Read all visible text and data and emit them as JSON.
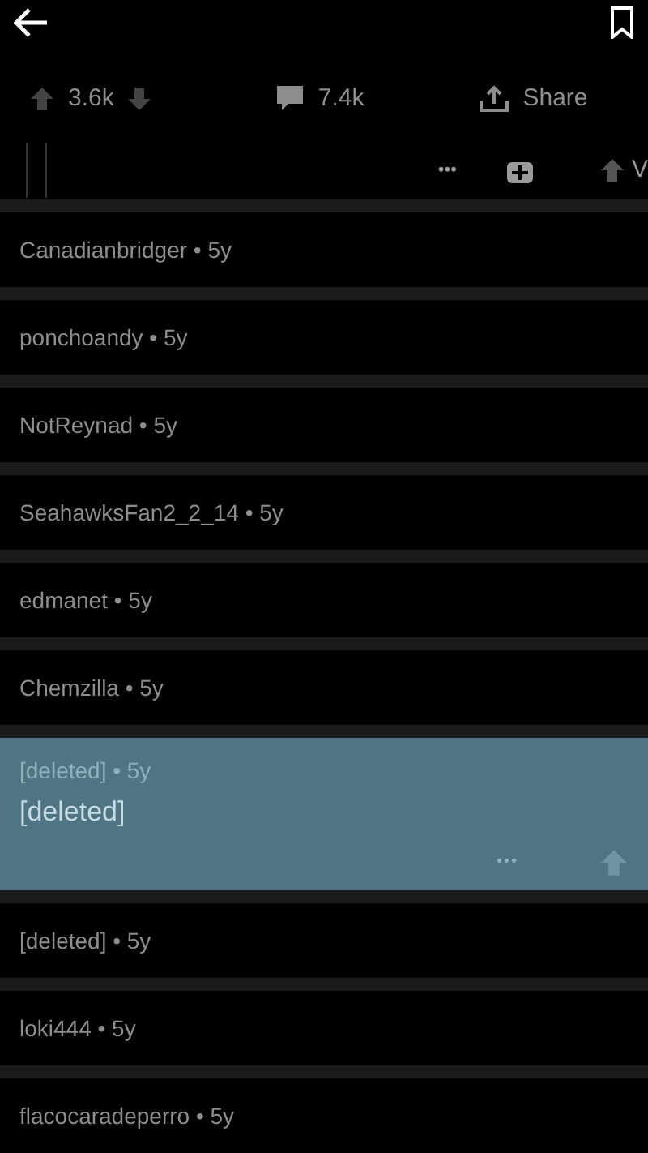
{
  "post_stats": {
    "score": "3.6k",
    "comments": "7.4k",
    "share": "Share"
  },
  "post_toolbar": {
    "more": "•••",
    "cut_label": "V"
  },
  "comments": [
    {
      "meta": "Canadianbridger • 5y",
      "selected": false
    },
    {
      "meta": "ponchoandy • 5y",
      "selected": false
    },
    {
      "meta": "NotReynad • 5y",
      "selected": false
    },
    {
      "meta": "SeahawksFan2_2_14 • 5y",
      "selected": false
    },
    {
      "meta": "edmanet • 5y",
      "selected": false
    },
    {
      "meta": "Chemzilla • 5y",
      "selected": false
    },
    {
      "meta": "[deleted] • 5y",
      "selected": true,
      "body": "[deleted]",
      "more": "•••"
    },
    {
      "meta": "[deleted] • 5y",
      "selected": false
    },
    {
      "meta": "loki444 • 5y",
      "selected": false
    },
    {
      "meta": "flacocaradeperro • 5y",
      "selected": false
    }
  ]
}
